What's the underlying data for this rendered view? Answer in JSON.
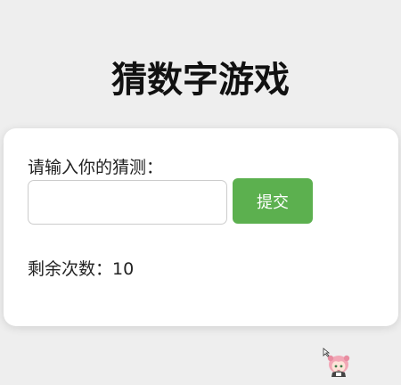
{
  "title": "猜数字游戏",
  "form": {
    "prompt_label": "请输入你的猜测：",
    "input_value": "",
    "input_placeholder": "",
    "submit_label": "提交"
  },
  "status": {
    "remaining_label": "剩余次数：",
    "remaining_count": "10"
  },
  "colors": {
    "background": "#eeeeee",
    "card": "#ffffff",
    "submit_button": "#5cb04f"
  },
  "icons": {
    "mascot": "anime-girl-mascot-icon"
  }
}
